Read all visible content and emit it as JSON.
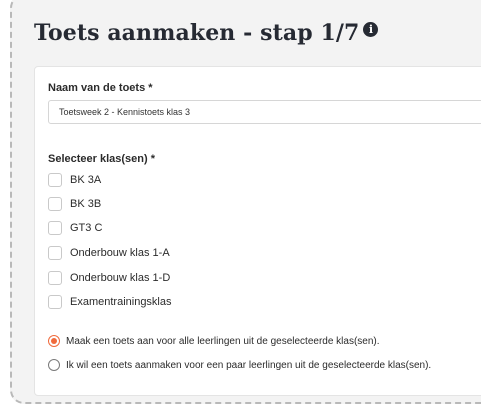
{
  "header": {
    "title": "Toets aanmaken - stap 1/7",
    "info_icon_glyph": "i"
  },
  "form": {
    "name_label": "Naam van de toets *",
    "name_value": "Toetsweek 2 - Kennistoets klas 3",
    "classes_label": "Selecteer klas(sen) *",
    "classes": [
      {
        "label": "BK 3A",
        "checked": false
      },
      {
        "label": "BK 3B",
        "checked": false
      },
      {
        "label": "GT3 C",
        "checked": false
      },
      {
        "label": "Onderbouw klas 1-A",
        "checked": false
      },
      {
        "label": "Onderbouw klas 1-D",
        "checked": false
      },
      {
        "label": "Examentrainingsklas",
        "checked": false
      }
    ],
    "scope_options": [
      {
        "label": "Maak een toets aan voor alle leerlingen uit de geselecteerde klas(sen).",
        "selected": true
      },
      {
        "label": "Ik wil een toets aanmaken voor een paar leerlingen uit de geselecteerde klas(sen).",
        "selected": false
      }
    ]
  },
  "colors": {
    "accent": "#f06a3c",
    "title": "#262a33"
  }
}
